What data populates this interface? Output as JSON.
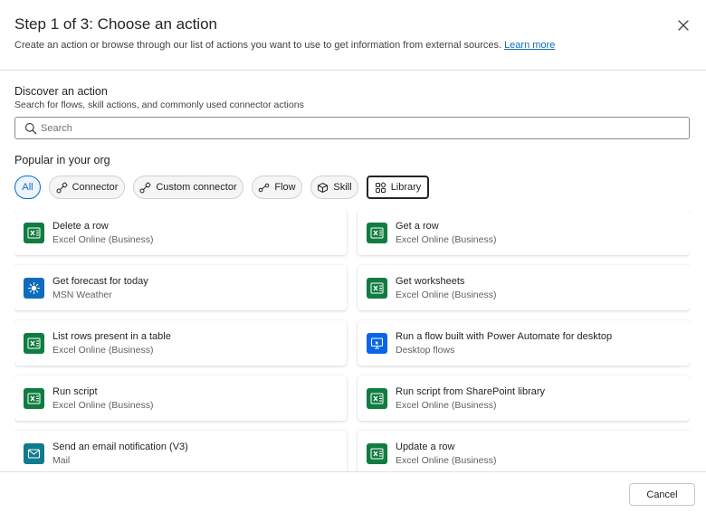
{
  "header": {
    "title": "Step 1 of 3: Choose an action",
    "subtitle": "Create an action or browse through our list of actions you want to use to get information from external sources.",
    "learn_more": "Learn more"
  },
  "discover": {
    "title": "Discover an action",
    "description": "Search for flows, skill actions, and commonly used connector actions"
  },
  "search": {
    "placeholder": "Search",
    "value": ""
  },
  "popular": {
    "title": "Popular in your org",
    "filters": [
      {
        "label": "All",
        "icon": "",
        "state": "selected"
      },
      {
        "label": "Connector",
        "icon": "connector-icon"
      },
      {
        "label": "Custom connector",
        "icon": "custom-connector-icon"
      },
      {
        "label": "Flow",
        "icon": "flow-icon"
      },
      {
        "label": "Skill",
        "icon": "skill-icon"
      },
      {
        "label": "Library",
        "icon": "library-icon",
        "state": "focused"
      }
    ]
  },
  "actions": [
    {
      "name": "Delete a row",
      "source": "Excel Online (Business)",
      "icon": "excel-icon"
    },
    {
      "name": "Get a row",
      "source": "Excel Online (Business)",
      "icon": "excel-icon"
    },
    {
      "name": "Get forecast for today",
      "source": "MSN Weather",
      "icon": "weather-icon"
    },
    {
      "name": "Get worksheets",
      "source": "Excel Online (Business)",
      "icon": "excel-icon"
    },
    {
      "name": "List rows present in a table",
      "source": "Excel Online (Business)",
      "icon": "excel-icon"
    },
    {
      "name": "Run a flow built with Power Automate for desktop",
      "source": "Desktop flows",
      "icon": "desktop-flow-icon"
    },
    {
      "name": "Run script",
      "source": "Excel Online (Business)",
      "icon": "excel-icon"
    },
    {
      "name": "Run script from SharePoint library",
      "source": "Excel Online (Business)",
      "icon": "excel-icon"
    },
    {
      "name": "Send an email notification (V3)",
      "source": "Mail",
      "icon": "mail-icon"
    },
    {
      "name": "Update a row",
      "source": "Excel Online (Business)",
      "icon": "excel-icon"
    }
  ],
  "footer": {
    "cancel_label": "Cancel"
  },
  "colors": {
    "accent": "#0f6cbd",
    "excel": "#107c41",
    "desktop": "#0a66e8",
    "mail": "#0f7b8f"
  }
}
